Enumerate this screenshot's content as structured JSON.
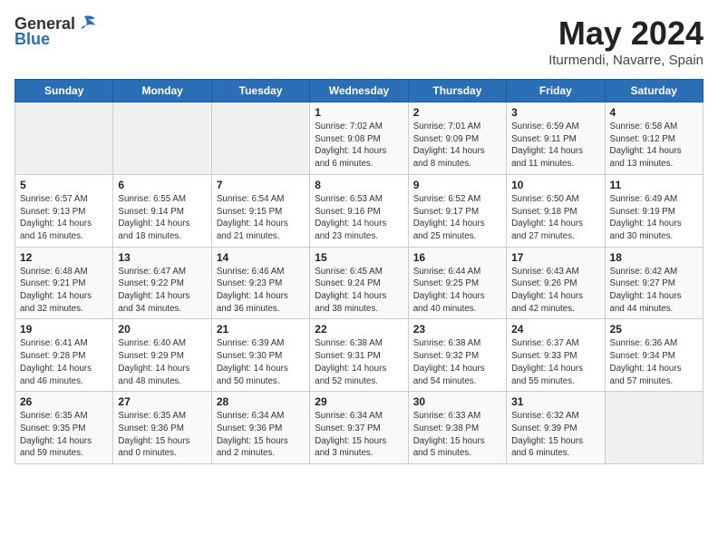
{
  "header": {
    "logo_general": "General",
    "logo_blue": "Blue",
    "title": "May 2024",
    "subtitle": "Iturmendi, Navarre, Spain"
  },
  "calendar": {
    "days_of_week": [
      "Sunday",
      "Monday",
      "Tuesday",
      "Wednesday",
      "Thursday",
      "Friday",
      "Saturday"
    ],
    "weeks": [
      [
        {
          "day": "",
          "sunrise": "",
          "sunset": "",
          "daylight": ""
        },
        {
          "day": "",
          "sunrise": "",
          "sunset": "",
          "daylight": ""
        },
        {
          "day": "",
          "sunrise": "",
          "sunset": "",
          "daylight": ""
        },
        {
          "day": "1",
          "sunrise": "Sunrise: 7:02 AM",
          "sunset": "Sunset: 9:08 PM",
          "daylight": "Daylight: 14 hours and 6 minutes."
        },
        {
          "day": "2",
          "sunrise": "Sunrise: 7:01 AM",
          "sunset": "Sunset: 9:09 PM",
          "daylight": "Daylight: 14 hours and 8 minutes."
        },
        {
          "day": "3",
          "sunrise": "Sunrise: 6:59 AM",
          "sunset": "Sunset: 9:11 PM",
          "daylight": "Daylight: 14 hours and 11 minutes."
        },
        {
          "day": "4",
          "sunrise": "Sunrise: 6:58 AM",
          "sunset": "Sunset: 9:12 PM",
          "daylight": "Daylight: 14 hours and 13 minutes."
        }
      ],
      [
        {
          "day": "5",
          "sunrise": "Sunrise: 6:57 AM",
          "sunset": "Sunset: 9:13 PM",
          "daylight": "Daylight: 14 hours and 16 minutes."
        },
        {
          "day": "6",
          "sunrise": "Sunrise: 6:55 AM",
          "sunset": "Sunset: 9:14 PM",
          "daylight": "Daylight: 14 hours and 18 minutes."
        },
        {
          "day": "7",
          "sunrise": "Sunrise: 6:54 AM",
          "sunset": "Sunset: 9:15 PM",
          "daylight": "Daylight: 14 hours and 21 minutes."
        },
        {
          "day": "8",
          "sunrise": "Sunrise: 6:53 AM",
          "sunset": "Sunset: 9:16 PM",
          "daylight": "Daylight: 14 hours and 23 minutes."
        },
        {
          "day": "9",
          "sunrise": "Sunrise: 6:52 AM",
          "sunset": "Sunset: 9:17 PM",
          "daylight": "Daylight: 14 hours and 25 minutes."
        },
        {
          "day": "10",
          "sunrise": "Sunrise: 6:50 AM",
          "sunset": "Sunset: 9:18 PM",
          "daylight": "Daylight: 14 hours and 27 minutes."
        },
        {
          "day": "11",
          "sunrise": "Sunrise: 6:49 AM",
          "sunset": "Sunset: 9:19 PM",
          "daylight": "Daylight: 14 hours and 30 minutes."
        }
      ],
      [
        {
          "day": "12",
          "sunrise": "Sunrise: 6:48 AM",
          "sunset": "Sunset: 9:21 PM",
          "daylight": "Daylight: 14 hours and 32 minutes."
        },
        {
          "day": "13",
          "sunrise": "Sunrise: 6:47 AM",
          "sunset": "Sunset: 9:22 PM",
          "daylight": "Daylight: 14 hours and 34 minutes."
        },
        {
          "day": "14",
          "sunrise": "Sunrise: 6:46 AM",
          "sunset": "Sunset: 9:23 PM",
          "daylight": "Daylight: 14 hours and 36 minutes."
        },
        {
          "day": "15",
          "sunrise": "Sunrise: 6:45 AM",
          "sunset": "Sunset: 9:24 PM",
          "daylight": "Daylight: 14 hours and 38 minutes."
        },
        {
          "day": "16",
          "sunrise": "Sunrise: 6:44 AM",
          "sunset": "Sunset: 9:25 PM",
          "daylight": "Daylight: 14 hours and 40 minutes."
        },
        {
          "day": "17",
          "sunrise": "Sunrise: 6:43 AM",
          "sunset": "Sunset: 9:26 PM",
          "daylight": "Daylight: 14 hours and 42 minutes."
        },
        {
          "day": "18",
          "sunrise": "Sunrise: 6:42 AM",
          "sunset": "Sunset: 9:27 PM",
          "daylight": "Daylight: 14 hours and 44 minutes."
        }
      ],
      [
        {
          "day": "19",
          "sunrise": "Sunrise: 6:41 AM",
          "sunset": "Sunset: 9:28 PM",
          "daylight": "Daylight: 14 hours and 46 minutes."
        },
        {
          "day": "20",
          "sunrise": "Sunrise: 6:40 AM",
          "sunset": "Sunset: 9:29 PM",
          "daylight": "Daylight: 14 hours and 48 minutes."
        },
        {
          "day": "21",
          "sunrise": "Sunrise: 6:39 AM",
          "sunset": "Sunset: 9:30 PM",
          "daylight": "Daylight: 14 hours and 50 minutes."
        },
        {
          "day": "22",
          "sunrise": "Sunrise: 6:38 AM",
          "sunset": "Sunset: 9:31 PM",
          "daylight": "Daylight: 14 hours and 52 minutes."
        },
        {
          "day": "23",
          "sunrise": "Sunrise: 6:38 AM",
          "sunset": "Sunset: 9:32 PM",
          "daylight": "Daylight: 14 hours and 54 minutes."
        },
        {
          "day": "24",
          "sunrise": "Sunrise: 6:37 AM",
          "sunset": "Sunset: 9:33 PM",
          "daylight": "Daylight: 14 hours and 55 minutes."
        },
        {
          "day": "25",
          "sunrise": "Sunrise: 6:36 AM",
          "sunset": "Sunset: 9:34 PM",
          "daylight": "Daylight: 14 hours and 57 minutes."
        }
      ],
      [
        {
          "day": "26",
          "sunrise": "Sunrise: 6:35 AM",
          "sunset": "Sunset: 9:35 PM",
          "daylight": "Daylight: 14 hours and 59 minutes."
        },
        {
          "day": "27",
          "sunrise": "Sunrise: 6:35 AM",
          "sunset": "Sunset: 9:36 PM",
          "daylight": "Daylight: 15 hours and 0 minutes."
        },
        {
          "day": "28",
          "sunrise": "Sunrise: 6:34 AM",
          "sunset": "Sunset: 9:36 PM",
          "daylight": "Daylight: 15 hours and 2 minutes."
        },
        {
          "day": "29",
          "sunrise": "Sunrise: 6:34 AM",
          "sunset": "Sunset: 9:37 PM",
          "daylight": "Daylight: 15 hours and 3 minutes."
        },
        {
          "day": "30",
          "sunrise": "Sunrise: 6:33 AM",
          "sunset": "Sunset: 9:38 PM",
          "daylight": "Daylight: 15 hours and 5 minutes."
        },
        {
          "day": "31",
          "sunrise": "Sunrise: 6:32 AM",
          "sunset": "Sunset: 9:39 PM",
          "daylight": "Daylight: 15 hours and 6 minutes."
        },
        {
          "day": "",
          "sunrise": "",
          "sunset": "",
          "daylight": ""
        }
      ]
    ]
  }
}
